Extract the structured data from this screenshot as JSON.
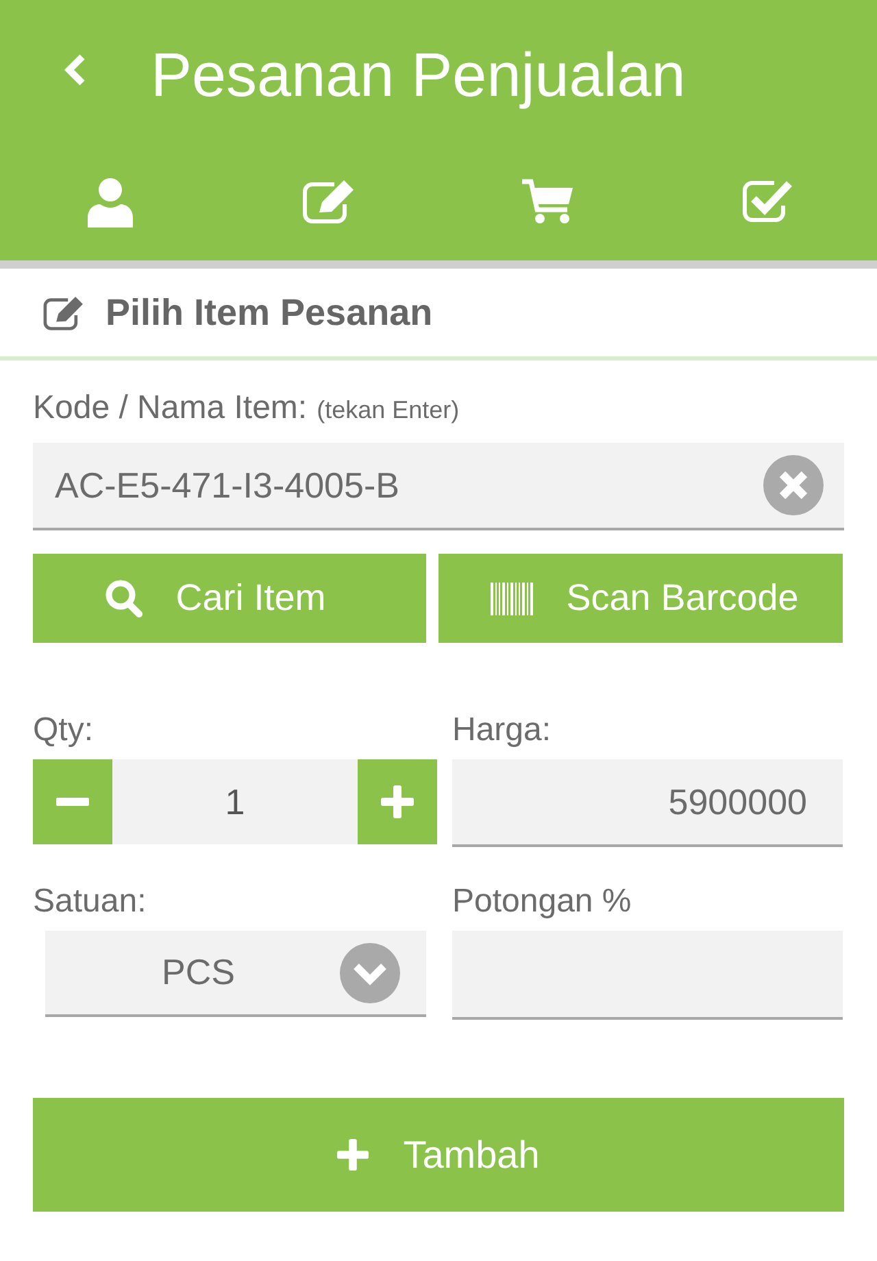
{
  "header": {
    "title": "Pesanan Penjualan"
  },
  "section": {
    "title": "Pilih Item Pesanan"
  },
  "item_field": {
    "label": "Kode / Nama Item:",
    "hint": "(tekan Enter)",
    "value": "AC-E5-471-I3-4005-B"
  },
  "buttons": [
    {
      "kind": "search",
      "label": "Cari Item"
    },
    {
      "kind": "barcode",
      "label": "Scan Barcode"
    }
  ],
  "qty": {
    "label": "Qty:",
    "value": "1"
  },
  "price": {
    "label": "Harga:",
    "value": "5900000"
  },
  "unit": {
    "label": "Satuan:",
    "value": "PCS"
  },
  "discount": {
    "label": "Potongan %"
  },
  "add_button": {
    "label": "Tambah"
  }
}
